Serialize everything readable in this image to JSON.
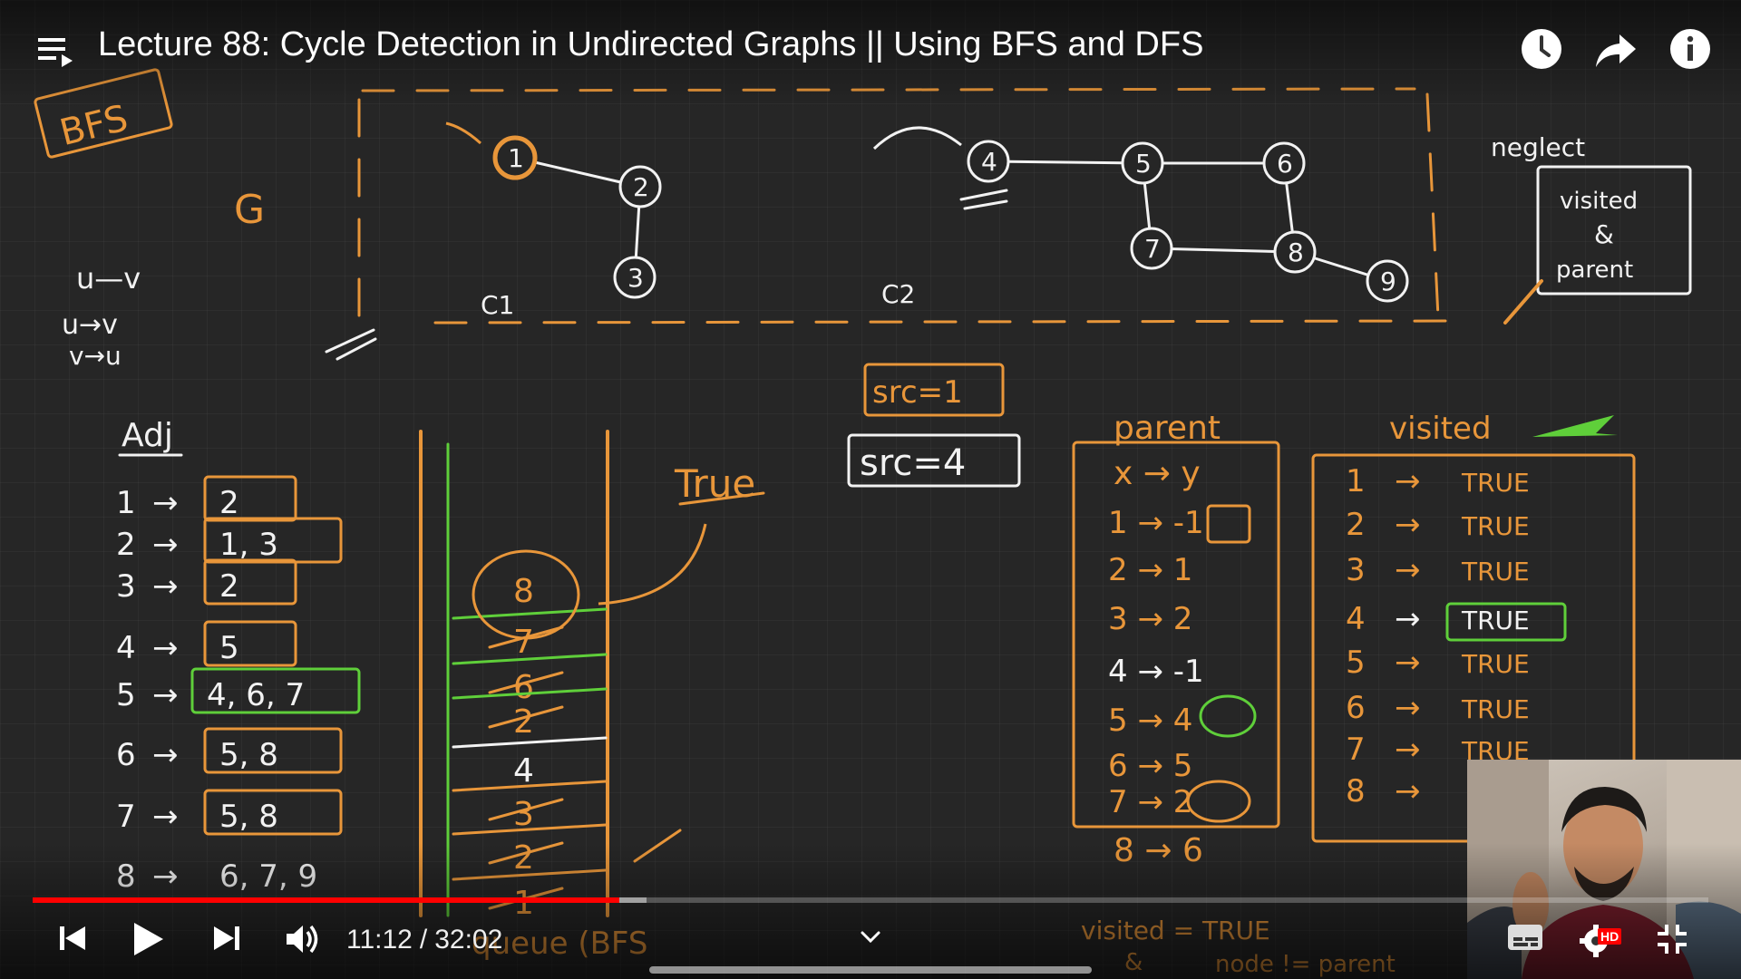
{
  "player": {
    "title": "Lecture 88: Cycle Detection in Undirected Graphs || Using BFS and DFS",
    "current_time": "11:12",
    "duration": "32:02",
    "progress_fraction": 0.35,
    "buffered_fraction": 0.3665,
    "quality_badge": "HD",
    "accent_color": "#ff0000",
    "icons": {
      "playlist": "playlist-icon",
      "watch_later": "clock-icon",
      "share": "share-icon",
      "info": "info-icon",
      "previous": "skip-previous-icon",
      "play": "play-icon",
      "next": "skip-next-icon",
      "volume": "volume-icon",
      "subtitles": "subtitles-icon",
      "settings": "settings-icon",
      "fullscreen": "exit-fullscreen-icon",
      "more": "chevron-down-icon"
    }
  },
  "whiteboard": {
    "colors": {
      "orange": "#e8963a",
      "white": "#f2f2f2",
      "green": "#5fcf3a"
    },
    "bfs_box": "BFS",
    "graph_label": "G",
    "edge_notes": [
      "u—v",
      "u→v",
      "v→u"
    ],
    "component_labels": [
      "C1",
      "C2"
    ],
    "nodes": [
      "1",
      "2",
      "3",
      "4",
      "5",
      "6",
      "7",
      "8",
      "9"
    ],
    "neglect_note": "neglect",
    "visited_parent_note": [
      "visited",
      "&",
      "parent"
    ],
    "src_boxes": [
      "src=1",
      "src=4"
    ],
    "true_note": "True",
    "adj_title": "Adj",
    "adj_rows": [
      {
        "key": "1",
        "vals": "2"
      },
      {
        "key": "2",
        "vals": "1, 3"
      },
      {
        "key": "3",
        "vals": "2"
      },
      {
        "key": "4",
        "vals": "5"
      },
      {
        "key": "5",
        "vals": "4, 6, 7"
      },
      {
        "key": "6",
        "vals": "5, 8"
      },
      {
        "key": "7",
        "vals": "5, 8"
      },
      {
        "key": "8",
        "vals": "6, 7, 9"
      }
    ],
    "queue_items": [
      "8",
      "7",
      "6",
      "2",
      "4",
      "3",
      "2",
      "1"
    ],
    "queue_label": "queue (BFS",
    "parent_title": "parent",
    "parent_header": "x → y",
    "parent_rows": [
      {
        "key": "1",
        "val": "-1"
      },
      {
        "key": "2",
        "val": "1"
      },
      {
        "key": "3",
        "val": "2"
      },
      {
        "key": "4",
        "val": "-1"
      },
      {
        "key": "5",
        "val": "4"
      },
      {
        "key": "6",
        "val": "5"
      },
      {
        "key": "7",
        "val": "2"
      }
    ],
    "parent_extra": {
      "key": "8",
      "val": "6"
    },
    "visited_title": "visited",
    "visited_rows": [
      {
        "key": "1",
        "val": "TRUE"
      },
      {
        "key": "2",
        "val": "TRUE"
      },
      {
        "key": "3",
        "val": "TRUE"
      },
      {
        "key": "4",
        "val": "TRUE"
      },
      {
        "key": "5",
        "val": "TRUE"
      },
      {
        "key": "6",
        "val": "TRUE"
      },
      {
        "key": "7",
        "val": "TRUE"
      },
      {
        "key": "8",
        "val": ""
      }
    ],
    "bottom_notes": [
      "visited = TRUE",
      "&",
      "node != parent"
    ]
  }
}
